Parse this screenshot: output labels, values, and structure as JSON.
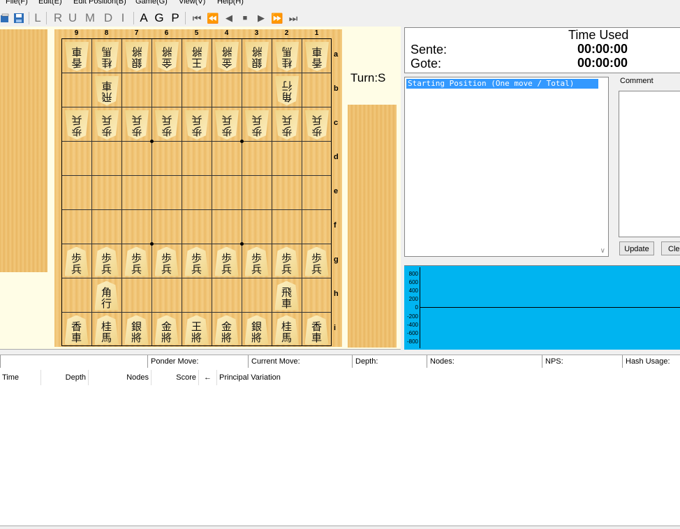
{
  "menu": [
    "File(F)",
    "Edit(E)",
    "Edit Position(B)",
    "Game(G)",
    "View(V)",
    "Help(H)"
  ],
  "toolbar": {
    "letters_gray": [
      "L",
      "R",
      "U",
      "M",
      "D",
      "I"
    ],
    "letters_dark": [
      "A",
      "G",
      "P"
    ],
    "nav": [
      "⏮",
      "⏪",
      "◀",
      "■",
      "▶",
      "⏩",
      "⏭"
    ]
  },
  "board": {
    "files": [
      "9",
      "8",
      "7",
      "6",
      "5",
      "4",
      "3",
      "2",
      "1"
    ],
    "ranks": [
      "a",
      "b",
      "c",
      "d",
      "e",
      "f",
      "g",
      "h",
      "i"
    ],
    "turn": "Turn:S",
    "gote_back": [
      [
        "香",
        "車"
      ],
      [
        "桂",
        "馬"
      ],
      [
        "銀",
        "將"
      ],
      [
        "金",
        "將"
      ],
      [
        "王",
        "將"
      ],
      [
        "金",
        "將"
      ],
      [
        "銀",
        "將"
      ],
      [
        "桂",
        "馬"
      ],
      [
        "香",
        "車"
      ]
    ],
    "gote_rook": [
      "飛",
      "車"
    ],
    "gote_bishop": [
      "角",
      "行"
    ],
    "pawn": [
      "歩",
      "兵"
    ],
    "sente_back": [
      [
        "香",
        "車"
      ],
      [
        "桂",
        "馬"
      ],
      [
        "銀",
        "將"
      ],
      [
        "金",
        "將"
      ],
      [
        "王",
        "將"
      ],
      [
        "金",
        "將"
      ],
      [
        "銀",
        "將"
      ],
      [
        "桂",
        "馬"
      ],
      [
        "香",
        "車"
      ]
    ],
    "sente_bishop": [
      "角",
      "行"
    ],
    "sente_rook": [
      "飛",
      "車"
    ]
  },
  "time": {
    "header": "Time Used",
    "sente_label": "Sente:",
    "gote_label": "Gote:",
    "sente_value": "00:00:00",
    "gote_value": "00:00:00"
  },
  "moves": {
    "selected": "Starting Position (One move / Total)"
  },
  "comment": {
    "label": "Comment",
    "update_button": "Update",
    "clear_button": "Clear"
  },
  "graph": {
    "ticks": [
      "800",
      "600",
      "400",
      "200",
      "0",
      "-200",
      "-400",
      "-600",
      "-800"
    ]
  },
  "status": {
    "ponder": "Ponder Move:",
    "current": "Current Move:",
    "depth": "Depth:",
    "nodes": "Nodes:",
    "nps": "NPS:",
    "hash": "Hash Usage:"
  },
  "analysis": {
    "columns": [
      "Time",
      "Depth",
      "Nodes",
      "Score",
      "←",
      "Principal Variation"
    ]
  },
  "colors": {
    "selection": "#3399ff",
    "graph_bg": "#00b4f0",
    "board_wood": "#f2c87c",
    "panel_bg": "#fffde6"
  }
}
